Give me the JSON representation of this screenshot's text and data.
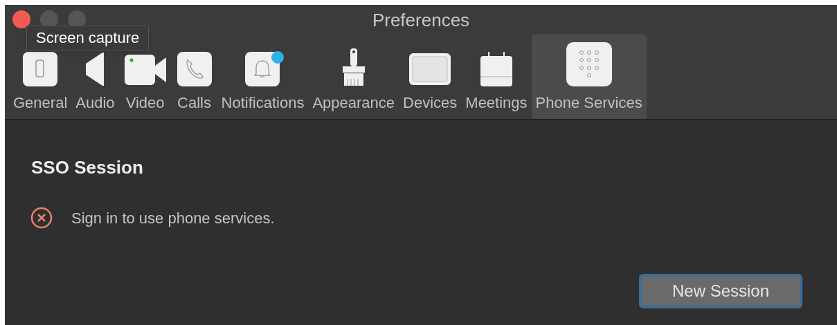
{
  "window": {
    "title": "Preferences"
  },
  "tooltip": "Screen capture",
  "tabs": [
    {
      "label": "General",
      "kind": "general",
      "selected": false,
      "badge": false
    },
    {
      "label": "Audio",
      "kind": "audio",
      "selected": false,
      "badge": false
    },
    {
      "label": "Video",
      "kind": "video",
      "selected": false,
      "badge": false
    },
    {
      "label": "Calls",
      "kind": "calls",
      "selected": false,
      "badge": false
    },
    {
      "label": "Notifications",
      "kind": "notifications",
      "selected": false,
      "badge": true
    },
    {
      "label": "Appearance",
      "kind": "appearance",
      "selected": false,
      "badge": false
    },
    {
      "label": "Devices",
      "kind": "devices",
      "selected": false,
      "badge": false
    },
    {
      "label": "Meetings",
      "kind": "meetings",
      "selected": false,
      "badge": false
    },
    {
      "label": "Phone Services",
      "kind": "phone",
      "selected": true,
      "badge": false
    }
  ],
  "section": {
    "heading": "SSO Session",
    "status": {
      "kind": "error",
      "message": "Sign in to use phone services."
    },
    "button": "New Session"
  }
}
